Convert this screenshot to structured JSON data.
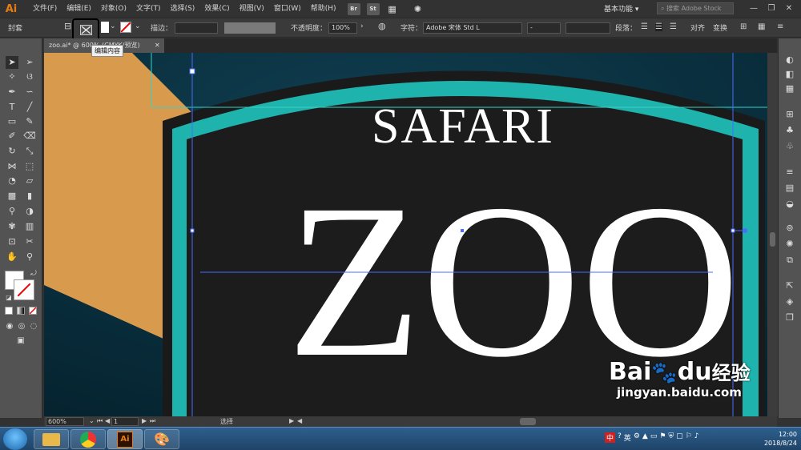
{
  "app": {
    "logo": "Ai"
  },
  "menubar": {
    "items": [
      "文件(F)",
      "编辑(E)",
      "对象(O)",
      "文字(T)",
      "选择(S)",
      "效果(C)",
      "视图(V)",
      "窗口(W)",
      "帮助(H)"
    ],
    "bridge": "Br",
    "stock": "St",
    "workspace": "基本功能",
    "search_placeholder": "搜索 Adobe Stock"
  },
  "control": {
    "group_label": "封套",
    "stroke_label": "描边：",
    "opacity_label": "不透明度：",
    "opacity_value": "100%",
    "char_label": "字符：",
    "font_value": "Adobe 宋体 Std L",
    "font_style": "-",
    "para_label": "段落：",
    "align_label": "对齐",
    "transform_label": "变换"
  },
  "tooltip": "编辑内容",
  "document": {
    "tab_title": "zoo.ai* @ 600% (CMYK/预览)"
  },
  "artwork": {
    "title_top": "SAFARI",
    "title_main": "ZOO"
  },
  "status": {
    "zoom": "600%",
    "artboard": "1",
    "tool_status": "选择"
  },
  "taskbar": {
    "app_label": "Ai",
    "ime": "英",
    "time": "12:00",
    "date": "2018/8/24"
  },
  "watermark": {
    "brand": "Bai",
    "brand2": "du",
    "cn": "经验",
    "url": "jingyan.baidu.com"
  },
  "colors": {
    "teal": "#1fb3ad",
    "orange": "#d89b4e",
    "navy": "#0c3a4b",
    "dark": "#1c1c1c"
  }
}
